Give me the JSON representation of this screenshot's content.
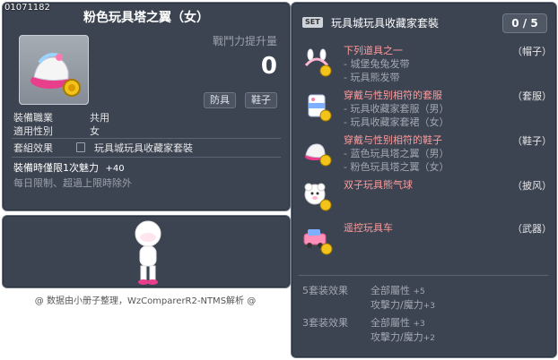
{
  "item": {
    "id": "01071182",
    "name": "粉色玩具塔之翼（女）",
    "power_label": "戰鬥力提升量",
    "power_value": "0",
    "tags": [
      "防具",
      "鞋子"
    ],
    "job_label": "裝備職業",
    "job_value": "共用",
    "gender_label": "適用性別",
    "gender_value": "女",
    "set_label": "套組效果",
    "set_value": "玩具城玩具收藏家套裝",
    "charm_label": "裝備時僅限1次魅力",
    "charm_value": "+40",
    "limit_note": "每日限制、超過上限時除外"
  },
  "footer": "@ 数据由小册子整理，WzComparerR2-NTMS解析 @",
  "set_panel": {
    "badge": "SET",
    "title": "玩具城玩具收藏家套裝",
    "progress": "0 / 5",
    "entries": [
      {
        "slot": "（帽子）",
        "lines": [
          "下列道具之一",
          "- 城堡兔兔发带",
          "- 玩具熊发带"
        ]
      },
      {
        "slot": "（套服）",
        "lines": [
          "穿戴与性别相符的套服",
          "- 玩具收藏家套服（男）",
          "- 玩具收藏家套裙（女）"
        ]
      },
      {
        "slot": "（鞋子）",
        "lines": [
          "穿戴与性别相符的鞋子",
          "- 蓝色玩具塔之翼（男）",
          "- 粉色玩具塔之翼（女）"
        ]
      },
      {
        "slot": "（披风）",
        "lines": [
          "双子玩具熊气球"
        ]
      },
      {
        "slot": "（武器）",
        "lines": [
          "遥控玩具车"
        ]
      }
    ],
    "bonuses": [
      {
        "label": "5套装效果",
        "rows": [
          {
            "name": "全部屬性",
            "value": "+5"
          },
          {
            "name": "攻擊力/魔力",
            "value": "+3"
          }
        ]
      },
      {
        "label": "3套装效果",
        "rows": [
          {
            "name": "全部屬性",
            "value": "+3"
          },
          {
            "name": "攻擊力/魔力",
            "value": "+2"
          }
        ]
      }
    ]
  }
}
